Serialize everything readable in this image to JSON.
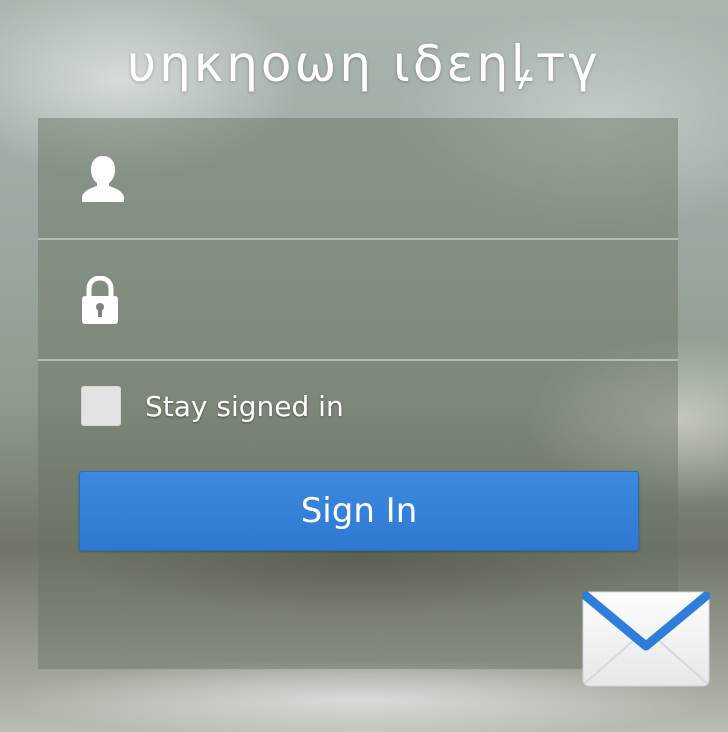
{
  "app": {
    "title": "υηκηοωη ιδεηꝲтγ"
  },
  "login": {
    "username": {
      "icon": "user-icon",
      "value": "",
      "placeholder": ""
    },
    "password": {
      "icon": "lock-icon",
      "value": "",
      "placeholder": ""
    },
    "stay_signed_in": {
      "label": "Stay signed in",
      "checked": false
    },
    "submit_label": "Sign In"
  },
  "footer": {
    "icon": "mail-icon"
  },
  "colors": {
    "accent": "#3583dc",
    "panel": "#6f7566",
    "checkbox": "#e1e4e3"
  }
}
